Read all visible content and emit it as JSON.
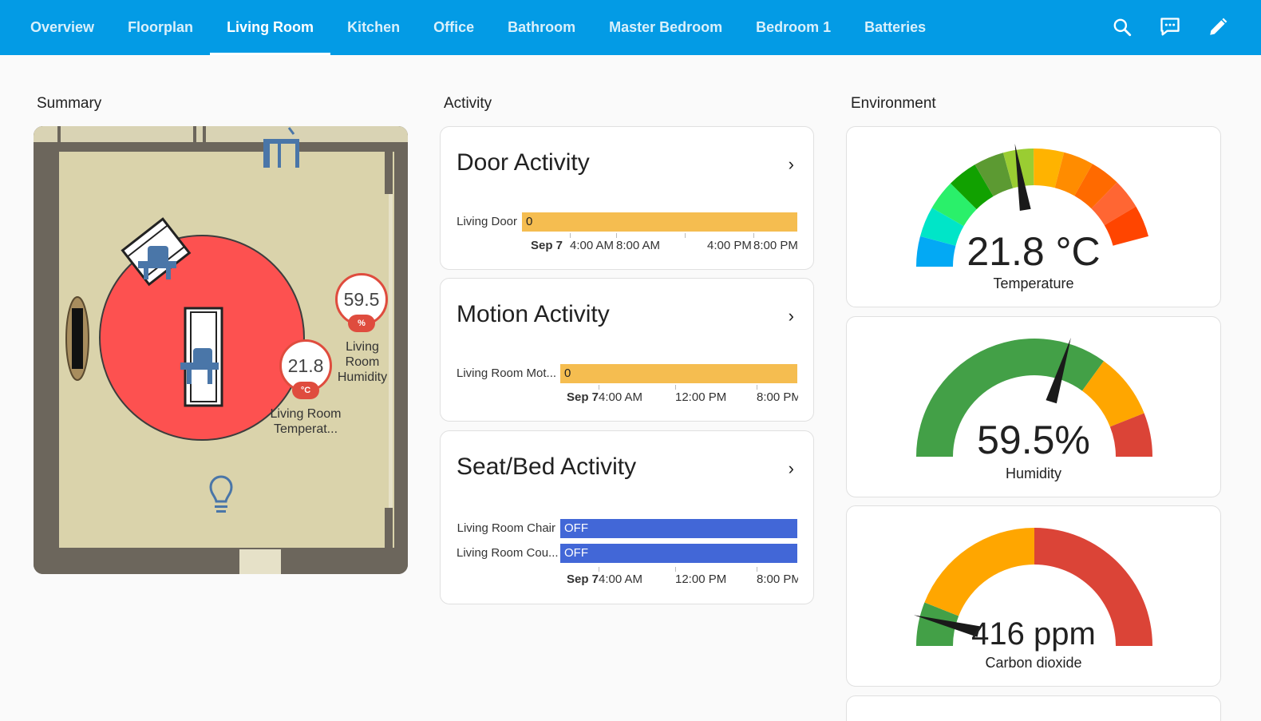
{
  "nav": {
    "tabs": [
      {
        "label": "Overview"
      },
      {
        "label": "Floorplan"
      },
      {
        "label": "Living Room"
      },
      {
        "label": "Kitchen"
      },
      {
        "label": "Office"
      },
      {
        "label": "Bathroom"
      },
      {
        "label": "Master Bedroom"
      },
      {
        "label": "Bedroom 1"
      },
      {
        "label": "Batteries"
      }
    ],
    "active_tab": "Living Room",
    "icons": [
      "search-icon",
      "chat-icon",
      "pencil-icon"
    ]
  },
  "colors": {
    "header": "#039be5",
    "active_zone": "#fd5150",
    "badge_red": "#df4c3e",
    "bar_yellow": "#f5bd50",
    "bar_blue": "#4267d7"
  },
  "summary": {
    "title": "Summary",
    "humidity_badge": {
      "value": "59.5",
      "unit": "%",
      "label": "Living Room Humidity"
    },
    "temperature_badge": {
      "value": "21.8",
      "unit": "°C",
      "label": "Living Room Temperat..."
    }
  },
  "activity": {
    "title": "Activity",
    "door": {
      "title": "Door Activity",
      "rows": [
        {
          "label": "Living Door",
          "state": "0"
        }
      ],
      "axis": {
        "date": "Sep 7",
        "t1": "4:00 AM",
        "t2": "8:00 AM",
        "t3": "4:00 PM",
        "t4": "8:00 PM"
      }
    },
    "motion": {
      "title": "Motion Activity",
      "rows": [
        {
          "label": "Living Room Mot...",
          "state": "0"
        }
      ],
      "axis": {
        "date": "Sep 7",
        "t1": "4:00 AM",
        "t2": "12:00 PM",
        "t3": "8:00 PM"
      }
    },
    "seat": {
      "title": "Seat/Bed Activity",
      "rows": [
        {
          "label": "Living Room Chair",
          "state": "OFF"
        },
        {
          "label": "Living Room Cou...",
          "state": "OFF"
        }
      ],
      "axis": {
        "date": "Sep 7",
        "t1": "4:00 AM",
        "t2": "12:00 PM",
        "t3": "8:00 PM"
      }
    }
  },
  "environment": {
    "title": "Environment",
    "temperature": {
      "value": "21.8 °C",
      "name": "Temperature",
      "level": 0.45
    },
    "humidity": {
      "value": "59.5%",
      "name": "Humidity",
      "level": 0.595
    },
    "co2": {
      "value": "416 ppm",
      "name": "Carbon dioxide",
      "level": 0.08
    }
  }
}
